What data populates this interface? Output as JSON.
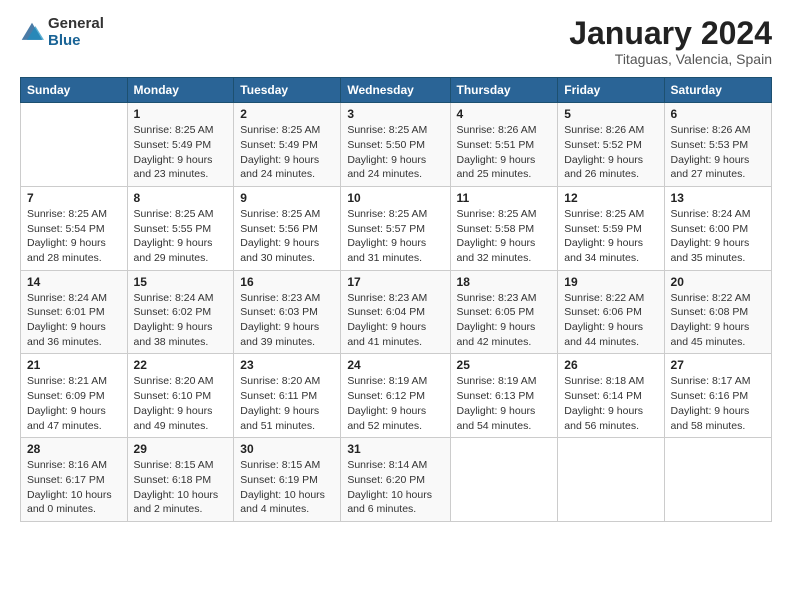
{
  "logo": {
    "general": "General",
    "blue": "Blue"
  },
  "header": {
    "title": "January 2024",
    "subtitle": "Titaguas, Valencia, Spain"
  },
  "columns": [
    "Sunday",
    "Monday",
    "Tuesday",
    "Wednesday",
    "Thursday",
    "Friday",
    "Saturday"
  ],
  "weeks": [
    [
      {
        "day": "",
        "text": ""
      },
      {
        "day": "1",
        "text": "Sunrise: 8:25 AM\nSunset: 5:49 PM\nDaylight: 9 hours\nand 23 minutes."
      },
      {
        "day": "2",
        "text": "Sunrise: 8:25 AM\nSunset: 5:49 PM\nDaylight: 9 hours\nand 24 minutes."
      },
      {
        "day": "3",
        "text": "Sunrise: 8:25 AM\nSunset: 5:50 PM\nDaylight: 9 hours\nand 24 minutes."
      },
      {
        "day": "4",
        "text": "Sunrise: 8:26 AM\nSunset: 5:51 PM\nDaylight: 9 hours\nand 25 minutes."
      },
      {
        "day": "5",
        "text": "Sunrise: 8:26 AM\nSunset: 5:52 PM\nDaylight: 9 hours\nand 26 minutes."
      },
      {
        "day": "6",
        "text": "Sunrise: 8:26 AM\nSunset: 5:53 PM\nDaylight: 9 hours\nand 27 minutes."
      }
    ],
    [
      {
        "day": "7",
        "text": "Sunrise: 8:25 AM\nSunset: 5:54 PM\nDaylight: 9 hours\nand 28 minutes."
      },
      {
        "day": "8",
        "text": "Sunrise: 8:25 AM\nSunset: 5:55 PM\nDaylight: 9 hours\nand 29 minutes."
      },
      {
        "day": "9",
        "text": "Sunrise: 8:25 AM\nSunset: 5:56 PM\nDaylight: 9 hours\nand 30 minutes."
      },
      {
        "day": "10",
        "text": "Sunrise: 8:25 AM\nSunset: 5:57 PM\nDaylight: 9 hours\nand 31 minutes."
      },
      {
        "day": "11",
        "text": "Sunrise: 8:25 AM\nSunset: 5:58 PM\nDaylight: 9 hours\nand 32 minutes."
      },
      {
        "day": "12",
        "text": "Sunrise: 8:25 AM\nSunset: 5:59 PM\nDaylight: 9 hours\nand 34 minutes."
      },
      {
        "day": "13",
        "text": "Sunrise: 8:24 AM\nSunset: 6:00 PM\nDaylight: 9 hours\nand 35 minutes."
      }
    ],
    [
      {
        "day": "14",
        "text": "Sunrise: 8:24 AM\nSunset: 6:01 PM\nDaylight: 9 hours\nand 36 minutes."
      },
      {
        "day": "15",
        "text": "Sunrise: 8:24 AM\nSunset: 6:02 PM\nDaylight: 9 hours\nand 38 minutes."
      },
      {
        "day": "16",
        "text": "Sunrise: 8:23 AM\nSunset: 6:03 PM\nDaylight: 9 hours\nand 39 minutes."
      },
      {
        "day": "17",
        "text": "Sunrise: 8:23 AM\nSunset: 6:04 PM\nDaylight: 9 hours\nand 41 minutes."
      },
      {
        "day": "18",
        "text": "Sunrise: 8:23 AM\nSunset: 6:05 PM\nDaylight: 9 hours\nand 42 minutes."
      },
      {
        "day": "19",
        "text": "Sunrise: 8:22 AM\nSunset: 6:06 PM\nDaylight: 9 hours\nand 44 minutes."
      },
      {
        "day": "20",
        "text": "Sunrise: 8:22 AM\nSunset: 6:08 PM\nDaylight: 9 hours\nand 45 minutes."
      }
    ],
    [
      {
        "day": "21",
        "text": "Sunrise: 8:21 AM\nSunset: 6:09 PM\nDaylight: 9 hours\nand 47 minutes."
      },
      {
        "day": "22",
        "text": "Sunrise: 8:20 AM\nSunset: 6:10 PM\nDaylight: 9 hours\nand 49 minutes."
      },
      {
        "day": "23",
        "text": "Sunrise: 8:20 AM\nSunset: 6:11 PM\nDaylight: 9 hours\nand 51 minutes."
      },
      {
        "day": "24",
        "text": "Sunrise: 8:19 AM\nSunset: 6:12 PM\nDaylight: 9 hours\nand 52 minutes."
      },
      {
        "day": "25",
        "text": "Sunrise: 8:19 AM\nSunset: 6:13 PM\nDaylight: 9 hours\nand 54 minutes."
      },
      {
        "day": "26",
        "text": "Sunrise: 8:18 AM\nSunset: 6:14 PM\nDaylight: 9 hours\nand 56 minutes."
      },
      {
        "day": "27",
        "text": "Sunrise: 8:17 AM\nSunset: 6:16 PM\nDaylight: 9 hours\nand 58 minutes."
      }
    ],
    [
      {
        "day": "28",
        "text": "Sunrise: 8:16 AM\nSunset: 6:17 PM\nDaylight: 10 hours\nand 0 minutes."
      },
      {
        "day": "29",
        "text": "Sunrise: 8:15 AM\nSunset: 6:18 PM\nDaylight: 10 hours\nand 2 minutes."
      },
      {
        "day": "30",
        "text": "Sunrise: 8:15 AM\nSunset: 6:19 PM\nDaylight: 10 hours\nand 4 minutes."
      },
      {
        "day": "31",
        "text": "Sunrise: 8:14 AM\nSunset: 6:20 PM\nDaylight: 10 hours\nand 6 minutes."
      },
      {
        "day": "",
        "text": ""
      },
      {
        "day": "",
        "text": ""
      },
      {
        "day": "",
        "text": ""
      }
    ]
  ]
}
